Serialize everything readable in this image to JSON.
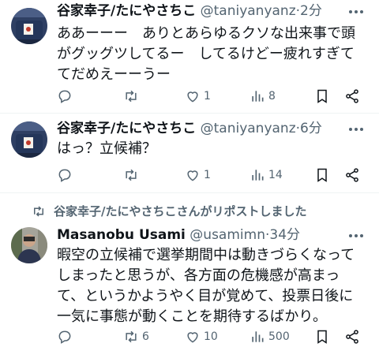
{
  "tweets": [
    {
      "author_name": "谷家幸子/たにやさちこ",
      "handle": "@taniyanyanz",
      "dot": "·",
      "time": "2分",
      "text": "ああーーー　ありとあらゆるクソな出来事で頭\nがグッグツしてるー　してるけどー疲れすぎて\nてだめえーーうー",
      "likes": "1",
      "views": "8"
    },
    {
      "author_name": "谷家幸子/たにやさちこ",
      "handle": "@taniyanyanz",
      "dot": "·",
      "time": "6分",
      "text": "はっ？立候補？",
      "likes": "1",
      "views": "14"
    },
    {
      "retweeted_by": "谷家幸子/たにやさちこさんがリポストしました",
      "author_name": "Masanobu Usami",
      "handle": "@usamimn",
      "dot": "·",
      "time": "34分",
      "text": "暇空の立候補で選挙期間中は動きづらくなって\nしまったと思うが、各方面の危機感が高まっ\nて、というかようやく目が覚めて、投票日後に\n一気に事態が動くことを期待するばかり。",
      "retweets": "6",
      "likes": "10",
      "views": "500"
    }
  ],
  "icons": {
    "reply": "speech-bubble",
    "retweet": "retweet-arrows",
    "like": "heart",
    "views": "bar-chart",
    "bookmark": "bookmark",
    "share": "share-nodes",
    "more": "three-dots"
  },
  "colors": {
    "text": "#0f1419",
    "secondary": "#536471",
    "separator": "#eff3f4"
  }
}
